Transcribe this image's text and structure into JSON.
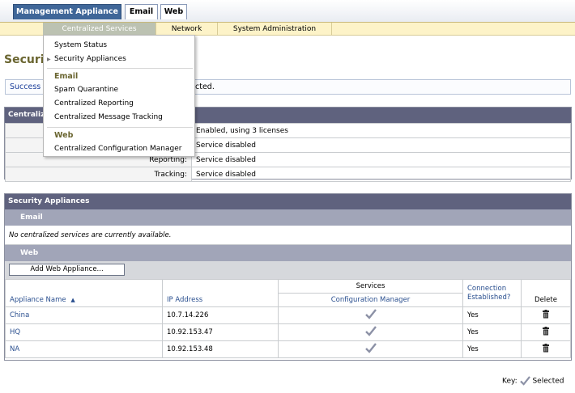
{
  "top_tabs": [
    "Management Appliance",
    "Email",
    "Web"
  ],
  "sub_tabs": [
    "Centralized Services",
    "Network",
    "System Administration"
  ],
  "page_title": "Security Appliances",
  "success_prefix": "Success",
  "success_suffix": "cted.",
  "dropdown": {
    "items_a": [
      "System Status",
      "Security Appliances"
    ],
    "group_email": "Email",
    "items_email": [
      "Spam Quarantine",
      "Centralized Reporting",
      "Centralized Message Tracking"
    ],
    "group_web": "Web",
    "items_web": [
      "Centralized Configuration Manager"
    ]
  },
  "central_panel": {
    "title": "Centraliz",
    "rows": [
      {
        "key": "",
        "value": "Enabled, using 3 licenses"
      },
      {
        "key": "",
        "value": "Service disabled"
      },
      {
        "key": "Reporting:",
        "value": "Service disabled"
      },
      {
        "key": "Tracking:",
        "value": "Service disabled"
      }
    ]
  },
  "sa_panel": {
    "title": "Security Appliances",
    "email_section": "Email",
    "email_note": "No centralized services are currently available.",
    "web_section": "Web",
    "add_button": "Add Web Appliance...",
    "columns": {
      "name": "Appliance Name",
      "ip": "IP Address",
      "services": "Services",
      "config": "Configuration Manager",
      "conn_line1": "Connection",
      "conn_line2": "Established?",
      "delete": "Delete"
    },
    "rows": [
      {
        "name": "China",
        "ip": "10.7.14.226",
        "conn": "Yes"
      },
      {
        "name": "HQ",
        "ip": "10.92.153.47",
        "conn": "Yes"
      },
      {
        "name": "NA",
        "ip": "10.92.153.48",
        "conn": "Yes"
      }
    ]
  },
  "key_label": "Key:",
  "key_selected": "Selected",
  "colors": {
    "accent_blue": "#3f6698",
    "panel_header": "#5f627e",
    "subnav_bg": "#fdf3c8",
    "title_olive": "#6a6530"
  }
}
